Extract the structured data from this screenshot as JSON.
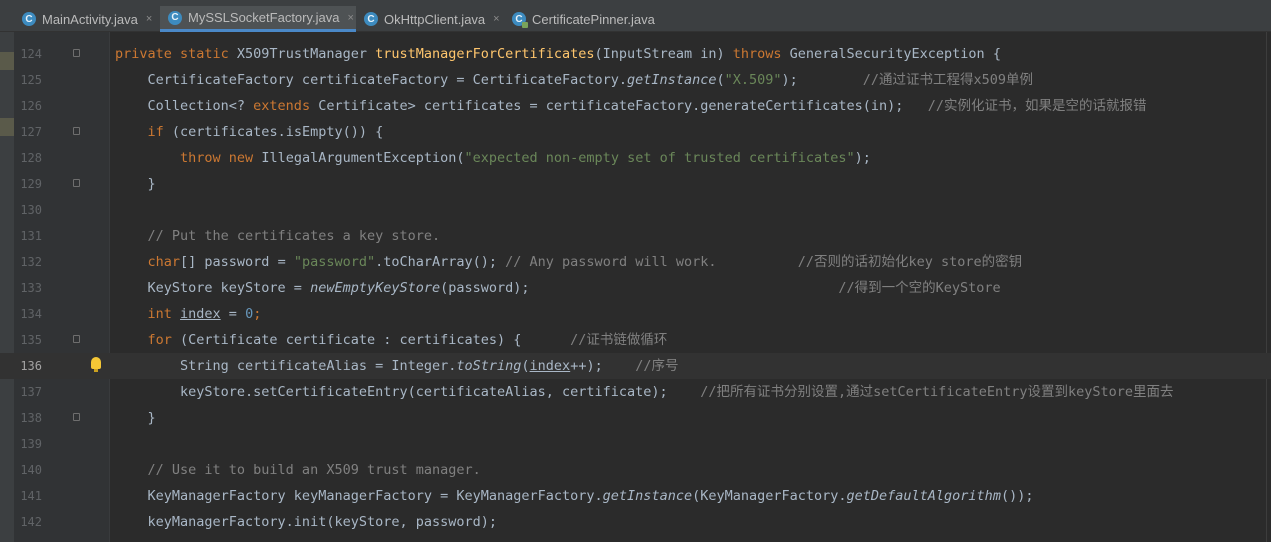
{
  "tabs": [
    {
      "label": "MainActivity.java",
      "icon": "java-class-icon",
      "active": false
    },
    {
      "label": "MySSLSocketFactory.java",
      "icon": "java-class-icon",
      "active": true
    },
    {
      "label": "OkHttpClient.java",
      "icon": "java-class-icon",
      "active": false
    },
    {
      "label": "CertificatePinner.java",
      "icon": "java-class-pinned-icon",
      "active": false
    }
  ],
  "tab_icon_letter": "C",
  "close_glyph": "×",
  "lines": [
    {
      "n": "124",
      "tokens": [
        [
          "kw",
          "private static "
        ],
        [
          "",
          "X509TrustManager "
        ],
        [
          "fn",
          "trustManagerForCertificates"
        ],
        [
          "",
          "(InputStream in) "
        ],
        [
          "kw",
          "throws "
        ],
        [
          "",
          "GeneralSecurityException {"
        ]
      ]
    },
    {
      "n": "125",
      "tokens": [
        [
          "",
          "    CertificateFactory certificateFactory = CertificateFactory."
        ],
        [
          "it",
          "getInstance"
        ],
        [
          "",
          "("
        ],
        [
          "str",
          "\"X.509\""
        ],
        [
          "",
          ");        "
        ],
        [
          "cmt",
          "//通过证书工程得x509单例"
        ]
      ]
    },
    {
      "n": "126",
      "tokens": [
        [
          "",
          "    Collection<? "
        ],
        [
          "kw",
          "extends "
        ],
        [
          "",
          "Certificate> certificates = certificateFactory.generateCertificates(in);   "
        ],
        [
          "cmt",
          "//实例化证书，如果是空的话就报错"
        ]
      ]
    },
    {
      "n": "127",
      "tokens": [
        [
          "kw",
          "    if "
        ],
        [
          "",
          "(certificates.isEmpty()) {"
        ]
      ]
    },
    {
      "n": "128",
      "tokens": [
        [
          "kw",
          "        throw new "
        ],
        [
          "",
          "IllegalArgumentException("
        ],
        [
          "str",
          "\"expected non-empty set of trusted certificates\""
        ],
        [
          "",
          ");"
        ]
      ]
    },
    {
      "n": "129",
      "tokens": [
        [
          "",
          "    }"
        ]
      ]
    },
    {
      "n": "130",
      "tokens": []
    },
    {
      "n": "131",
      "tokens": [
        [
          "cmt",
          "    // Put the certificates a key store."
        ]
      ]
    },
    {
      "n": "132",
      "tokens": [
        [
          "kw",
          "    char"
        ],
        [
          "",
          "[] password = "
        ],
        [
          "str",
          "\"password\""
        ],
        [
          "",
          ".toCharArray(); "
        ],
        [
          "cmt",
          "// Any password will work.          //否则的话初始化key store的密钥"
        ]
      ]
    },
    {
      "n": "133",
      "tokens": [
        [
          "",
          "    KeyStore keyStore = "
        ],
        [
          "it",
          "newEmptyKeyStore"
        ],
        [
          "",
          "(password);                                      "
        ],
        [
          "cmt",
          "//得到一个空的KeyStore"
        ]
      ]
    },
    {
      "n": "134",
      "tokens": [
        [
          "kw",
          "    int "
        ],
        [
          "ul",
          "index"
        ],
        [
          "",
          " = "
        ],
        [
          "num",
          "0"
        ],
        [
          "kw",
          ";"
        ]
      ]
    },
    {
      "n": "135",
      "tokens": [
        [
          "kw",
          "    for "
        ],
        [
          "",
          "(Certificate certificate : certificates) {      "
        ],
        [
          "cmt",
          "//证书链做循环"
        ]
      ]
    },
    {
      "n": "136",
      "tokens": [
        [
          "",
          "        String certificateAlias = Integer."
        ],
        [
          "it",
          "toString"
        ],
        [
          "",
          "("
        ],
        [
          "ul",
          "index"
        ],
        [
          "",
          "++);    "
        ],
        [
          "cmt",
          "//序号"
        ]
      ],
      "current": true
    },
    {
      "n": "137",
      "tokens": [
        [
          "",
          "        keyStore.setCertificateEntry(certificateAlias, certificate);    "
        ],
        [
          "cmt",
          "//把所有证书分别设置,通过setCertificateEntry设置到keyStore里面去"
        ]
      ]
    },
    {
      "n": "138",
      "tokens": [
        [
          "",
          "    }"
        ]
      ]
    },
    {
      "n": "139",
      "tokens": []
    },
    {
      "n": "140",
      "tokens": [
        [
          "cmt",
          "    // Use it to build an X509 trust manager."
        ]
      ]
    },
    {
      "n": "141",
      "tokens": [
        [
          "",
          "    KeyManagerFactory keyManagerFactory = KeyManagerFactory."
        ],
        [
          "it",
          "getInstance"
        ],
        [
          "",
          "(KeyManagerFactory."
        ],
        [
          "it",
          "getDefaultAlgorithm"
        ],
        [
          "",
          "());"
        ]
      ]
    },
    {
      "n": "142",
      "tokens": [
        [
          "",
          "    keyManagerFactory.init(keyStore, password);"
        ]
      ]
    }
  ],
  "colors": {
    "background": "#2b2b2b",
    "keyword": "#cc7832",
    "function": "#ffc66d",
    "string": "#6a8759",
    "comment": "#808080",
    "number": "#6897bb"
  }
}
